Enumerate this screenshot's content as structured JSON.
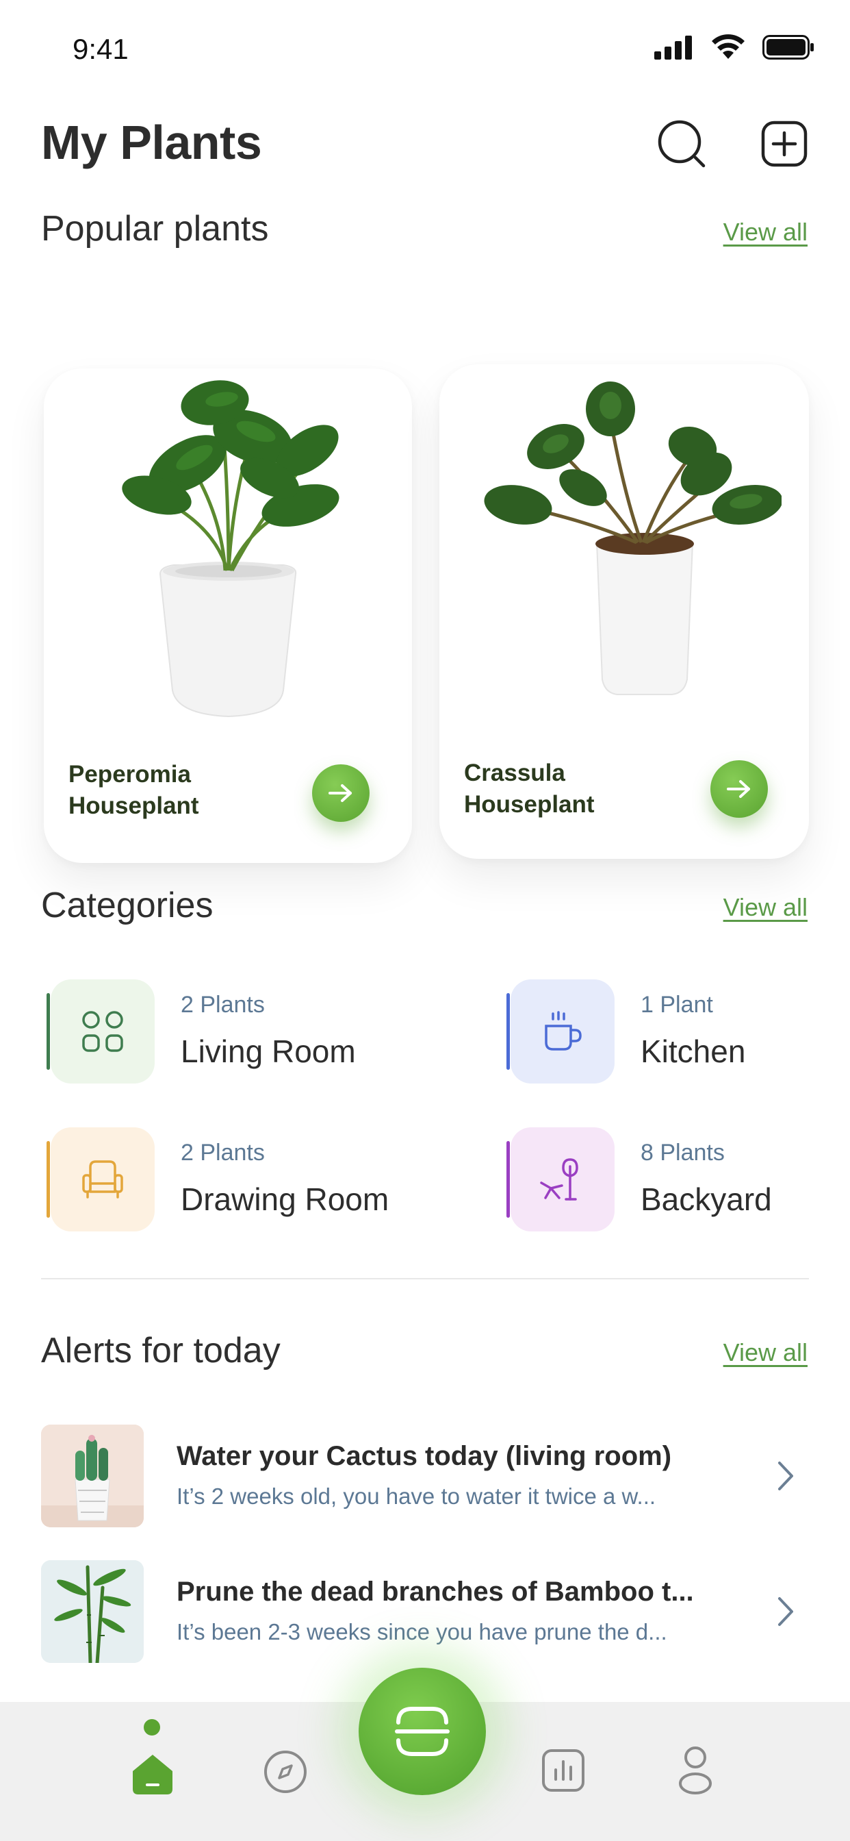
{
  "status_bar": {
    "time": "9:41"
  },
  "header": {
    "title": "My Plants"
  },
  "popular": {
    "title": "Popular plants",
    "view_all": "View all",
    "plants": [
      {
        "name_line1": "Peperomia",
        "name_line2": "Houseplant"
      },
      {
        "name_line1": "Crassula",
        "name_line2": "Houseplant"
      }
    ]
  },
  "categories": {
    "title": "Categories",
    "view_all": "View all",
    "items": [
      {
        "count": "2 Plants",
        "name": "Living Room",
        "icon": "grid-icon",
        "color": "#3f7d4f",
        "bg": "#edf6ea"
      },
      {
        "count": "1 Plant",
        "name": "Kitchen",
        "icon": "cup-icon",
        "color": "#4b6bd6",
        "bg": "#e6ebfb"
      },
      {
        "count": "2 Plants",
        "name": "Drawing Room",
        "icon": "armchair-icon",
        "color": "#e3a63a",
        "bg": "#fdf1e1"
      },
      {
        "count": "8 Plants",
        "name": "Backyard",
        "icon": "garden-chair-icon",
        "color": "#9a3fc2",
        "bg": "#f6e6f8"
      }
    ]
  },
  "alerts": {
    "title": "Alerts for today",
    "view_all": "View all",
    "items": [
      {
        "title": "Water your Cactus today (living room)",
        "desc": "It’s 2 weeks old, you have to water it twice a w..."
      },
      {
        "title": "Prune the dead branches of Bamboo t...",
        "desc": "It’s been 2-3 weeks since you have prune the d..."
      }
    ]
  },
  "colors": {
    "accent": "#5aa431",
    "link": "#5a9a48"
  },
  "bottom_nav": [
    "home-icon",
    "compass-icon",
    "scan-icon",
    "stats-icon",
    "profile-icon"
  ]
}
